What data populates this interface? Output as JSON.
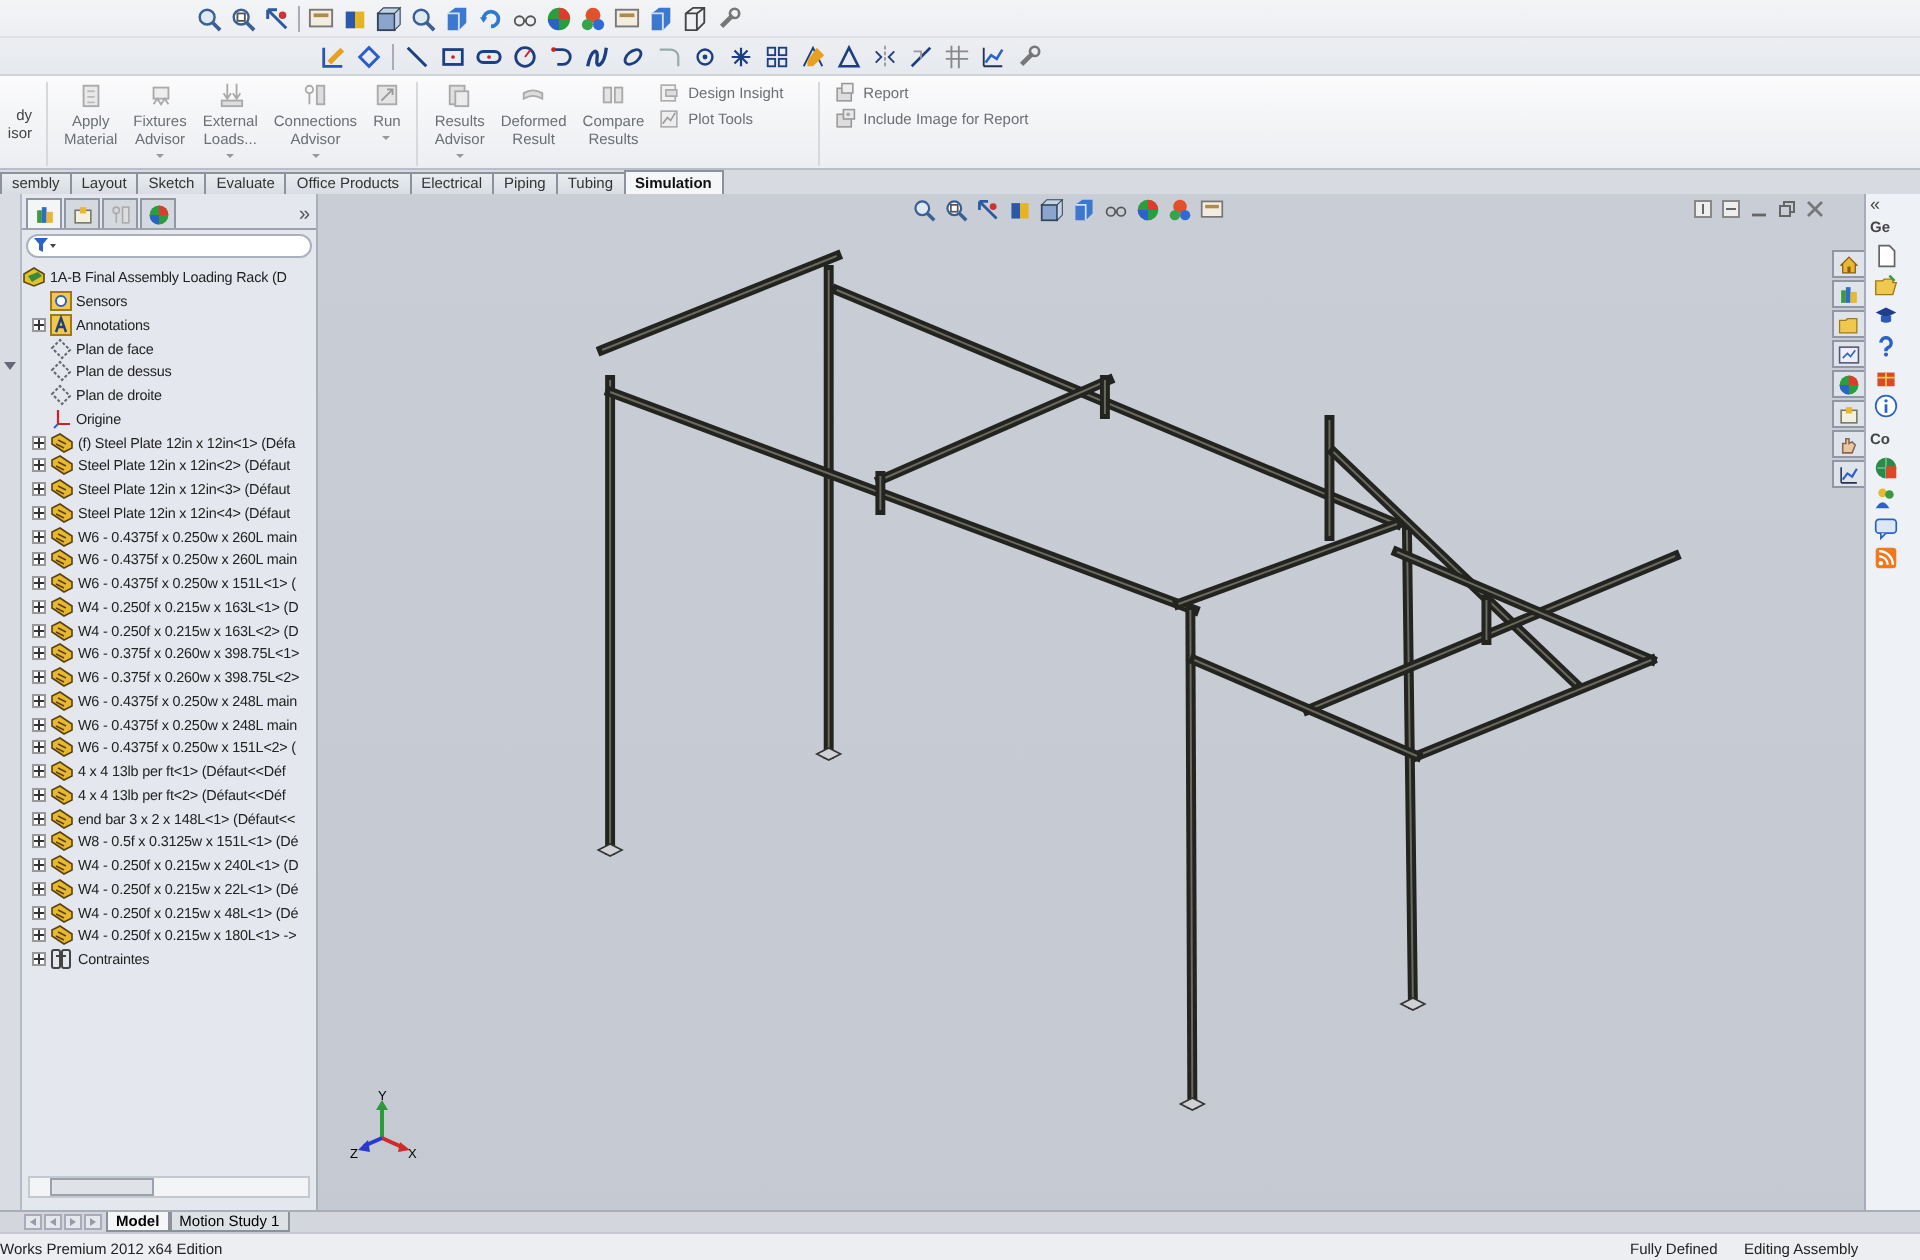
{
  "ribbon": {
    "items": [
      {
        "kind": "cut",
        "lines": [
          "dy",
          "isor"
        ]
      },
      {
        "kind": "separator"
      },
      {
        "kind": "large",
        "label": "Apply Material",
        "has_menu": false
      },
      {
        "kind": "large",
        "label": "Fixtures Advisor",
        "has_menu": true
      },
      {
        "kind": "large",
        "label": "External Loads...",
        "has_menu": true
      },
      {
        "kind": "large",
        "label": "Connections Advisor",
        "has_menu": true
      },
      {
        "kind": "large",
        "label": "Run",
        "has_menu": true
      },
      {
        "kind": "separator"
      },
      {
        "kind": "large",
        "label": "Results Advisor",
        "has_menu": true
      },
      {
        "kind": "large",
        "label": "Deformed Result",
        "has_menu": false
      },
      {
        "kind": "large",
        "label": "Compare Results",
        "has_menu": false
      },
      {
        "kind": "stack",
        "buttons": [
          {
            "label": "Design Insight"
          },
          {
            "label": "Plot Tools"
          }
        ]
      },
      {
        "kind": "separator"
      },
      {
        "kind": "stack",
        "buttons": [
          {
            "label": "Report"
          },
          {
            "label": "Include Image for Report"
          }
        ]
      }
    ]
  },
  "command_tabs": [
    {
      "label": "sembly",
      "selected": false
    },
    {
      "label": "Layout",
      "selected": false
    },
    {
      "label": "Sketch",
      "selected": false
    },
    {
      "label": "Evaluate",
      "selected": false
    },
    {
      "label": "Office Products",
      "selected": false
    },
    {
      "label": "Electrical",
      "selected": false
    },
    {
      "label": "Piping",
      "selected": false
    },
    {
      "label": "Tubing",
      "selected": false
    },
    {
      "label": "Simulation",
      "selected": true
    }
  ],
  "feature_tree": {
    "collapse": "»",
    "items": [
      {
        "kind": "root",
        "label": "1A-B Final Assembly Loading Rack  (D",
        "expandable": false
      },
      {
        "kind": "sensors",
        "label": "Sensors",
        "expandable": false
      },
      {
        "kind": "annotations",
        "label": "Annotations",
        "expandable": true
      },
      {
        "kind": "plane",
        "label": "Plan de face",
        "expandable": false
      },
      {
        "kind": "plane",
        "label": "Plan de dessus",
        "expandable": false
      },
      {
        "kind": "plane",
        "label": "Plan de droite",
        "expandable": false
      },
      {
        "kind": "origin",
        "label": "Origine",
        "expandable": false
      },
      {
        "kind": "part",
        "label": "(f) Steel Plate 12in x 12in<1> (Défa",
        "expandable": true
      },
      {
        "kind": "part",
        "label": "Steel Plate 12in x 12in<2> (Défaut",
        "expandable": true
      },
      {
        "kind": "part",
        "label": "Steel Plate 12in x 12in<3> (Défaut",
        "expandable": true
      },
      {
        "kind": "part",
        "label": "Steel Plate 12in x 12in<4> (Défaut",
        "expandable": true
      },
      {
        "kind": "part",
        "label": "W6 - 0.4375f x 0.250w x 260L main",
        "expandable": true
      },
      {
        "kind": "part",
        "label": "W6 - 0.4375f x 0.250w x 260L main",
        "expandable": true
      },
      {
        "kind": "part",
        "label": "W6 - 0.4375f x 0.250w x 151L<1> (",
        "expandable": true
      },
      {
        "kind": "part",
        "label": "W4 - 0.250f x 0.215w x 163L<1> (D",
        "expandable": true
      },
      {
        "kind": "part",
        "label": "W4 - 0.250f x 0.215w x 163L<2> (D",
        "expandable": true
      },
      {
        "kind": "part",
        "label": "W6 - 0.375f x 0.260w x 398.75L<1>",
        "expandable": true
      },
      {
        "kind": "part",
        "label": "W6 - 0.375f x 0.260w x 398.75L<2>",
        "expandable": true
      },
      {
        "kind": "part",
        "label": "W6 - 0.4375f x 0.250w x 248L main",
        "expandable": true
      },
      {
        "kind": "part",
        "label": "W6 - 0.4375f x 0.250w x 248L main",
        "expandable": true
      },
      {
        "kind": "part",
        "label": "W6 - 0.4375f x 0.250w x 151L<2> (",
        "expandable": true
      },
      {
        "kind": "part",
        "label": "4 x 4 13lb per ft<1> (Défaut<<Déf",
        "expandable": true
      },
      {
        "kind": "part",
        "label": "4 x 4 13lb per ft<2> (Défaut<<Déf",
        "expandable": true
      },
      {
        "kind": "part",
        "label": "end bar 3 x 2 x 148L<1> (Défaut<<",
        "expandable": true
      },
      {
        "kind": "part",
        "label": "W8 - 0.5f x 0.3125w x 151L<1> (Dé",
        "expandable": true
      },
      {
        "kind": "part",
        "label": "W4 - 0.250f x 0.215w x 240L<1> (D",
        "expandable": true
      },
      {
        "kind": "part",
        "label": "W4 - 0.250f x 0.215w x 22L<1> (Dé",
        "expandable": true
      },
      {
        "kind": "part",
        "label": "W4 - 0.250f x 0.215w x 48L<1> (Dé",
        "expandable": true
      },
      {
        "kind": "part",
        "label": "W4 - 0.250f x 0.215w x 180L<1> ->",
        "expandable": true
      },
      {
        "kind": "mates",
        "label": "Contraintes",
        "expandable": true
      }
    ]
  },
  "viewport": {
    "triad": {
      "x": "X",
      "y": "Y",
      "z": "Z"
    }
  },
  "task_pane": {
    "collapse": "«",
    "headings": [
      "Ge",
      "Co"
    ]
  },
  "bottom_tabs": [
    {
      "label": "Model",
      "selected": true
    },
    {
      "label": "Motion Study 1",
      "selected": false
    }
  ],
  "status_bar": {
    "edition": "Works Premium 2012 x64 Edition",
    "state": "Fully Defined",
    "mode": "Editing Assembly"
  }
}
